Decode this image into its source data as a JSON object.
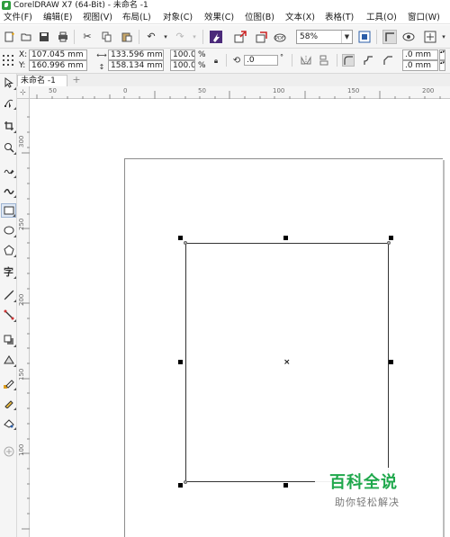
{
  "window": {
    "title": "CorelDRAW X7 (64-Bit) - 未命名 -1"
  },
  "menu": {
    "items": [
      "文件(F)",
      "编辑(E)",
      "视图(V)",
      "布局(L)",
      "对象(C)",
      "效果(C)",
      "位图(B)",
      "文本(X)",
      "表格(T)",
      "工具(O)",
      "窗口(W)"
    ]
  },
  "toolbar": {
    "zoom_value": "58%",
    "icons": [
      "new-icon",
      "open-icon",
      "save-icon",
      "print-icon",
      "cut-icon",
      "copy-icon",
      "paste-icon",
      "undo-icon",
      "redo-icon",
      "corel-connect-icon",
      "import-icon",
      "export-icon",
      "publish-pdf-icon",
      "full-screen-icon",
      "snap-icon",
      "view-icon",
      "options-icon"
    ]
  },
  "propbar": {
    "x_label": "X:",
    "x_value": "107.045 mm",
    "y_label": "Y:",
    "y_value": "160.996 mm",
    "width_value": "133.596 mm",
    "height_value": "158.134 mm",
    "scale_x": "100.0",
    "scale_y": "100.0",
    "percent": "%",
    "rotation_value": ".0",
    "rotation_unit": "°",
    "corner_top": ".0 mm",
    "corner_bottom": ".0 mm"
  },
  "tabs": {
    "document": "未命名 -1",
    "add": "+"
  },
  "rulers": {
    "horizontal_ticks": [
      "50",
      "0",
      "50",
      "100",
      "150",
      "200"
    ],
    "vertical_ticks": [
      "300",
      "250",
      "200",
      "150",
      "100"
    ],
    "corner_glyph": "⊹"
  },
  "canvas": {
    "center_marker": "×"
  },
  "watermark": {
    "title": "百科全说",
    "subtitle": "助你轻松解决"
  }
}
